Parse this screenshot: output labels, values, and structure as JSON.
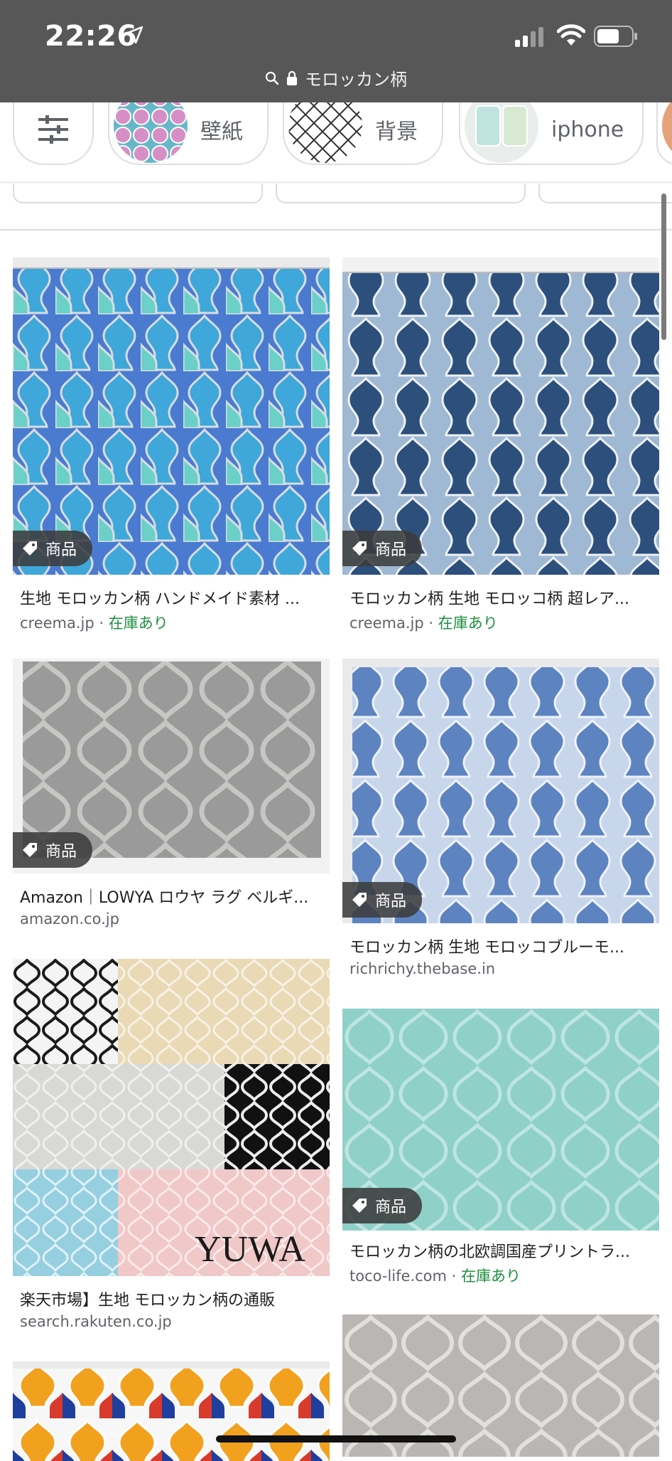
{
  "status": {
    "time": "22:26",
    "url": "モロッカン柄"
  },
  "chips": [
    {
      "label": "壁紙",
      "icon": "wallpaper-thumbnail"
    },
    {
      "label": "背景",
      "icon": "background-thumbnail"
    },
    {
      "label": "iphone",
      "icon": "iphone-case-thumbnail"
    }
  ],
  "results": [
    {
      "badge": "商品",
      "title": "生地 モロッカン柄 ハンドメイド素材 ...",
      "source": "creema.jp",
      "stock": "在庫あり"
    },
    {
      "badge": "商品",
      "title": "モロッカン柄 生地 モロッコ柄 超レア...",
      "source": "creema.jp",
      "stock": "在庫あり"
    },
    {
      "badge": "商品",
      "title": "Amazon｜LOWYA ロウヤ ラグ ベルギ...",
      "source": "amazon.co.jp",
      "stock": ""
    },
    {
      "badge": "商品",
      "title": "モロッカン柄 生地 モロッコブルーモ...",
      "source": "richrichy.thebase.in",
      "stock": ""
    },
    {
      "badge": "",
      "title": "楽天市場】生地 モロッカン柄の通販",
      "source": "search.rakuten.co.jp",
      "stock": "",
      "image_text": "YUWA"
    },
    {
      "badge": "商品",
      "title": "モロッカン柄の北欧調国産プリントラ...",
      "source": "toco-life.com",
      "stock": "在庫あり"
    }
  ],
  "stock_separator": " · ",
  "colors": {
    "status_bg": "#575757",
    "instock_green": "#1e8e3e",
    "link_grey": "#5f6368"
  }
}
